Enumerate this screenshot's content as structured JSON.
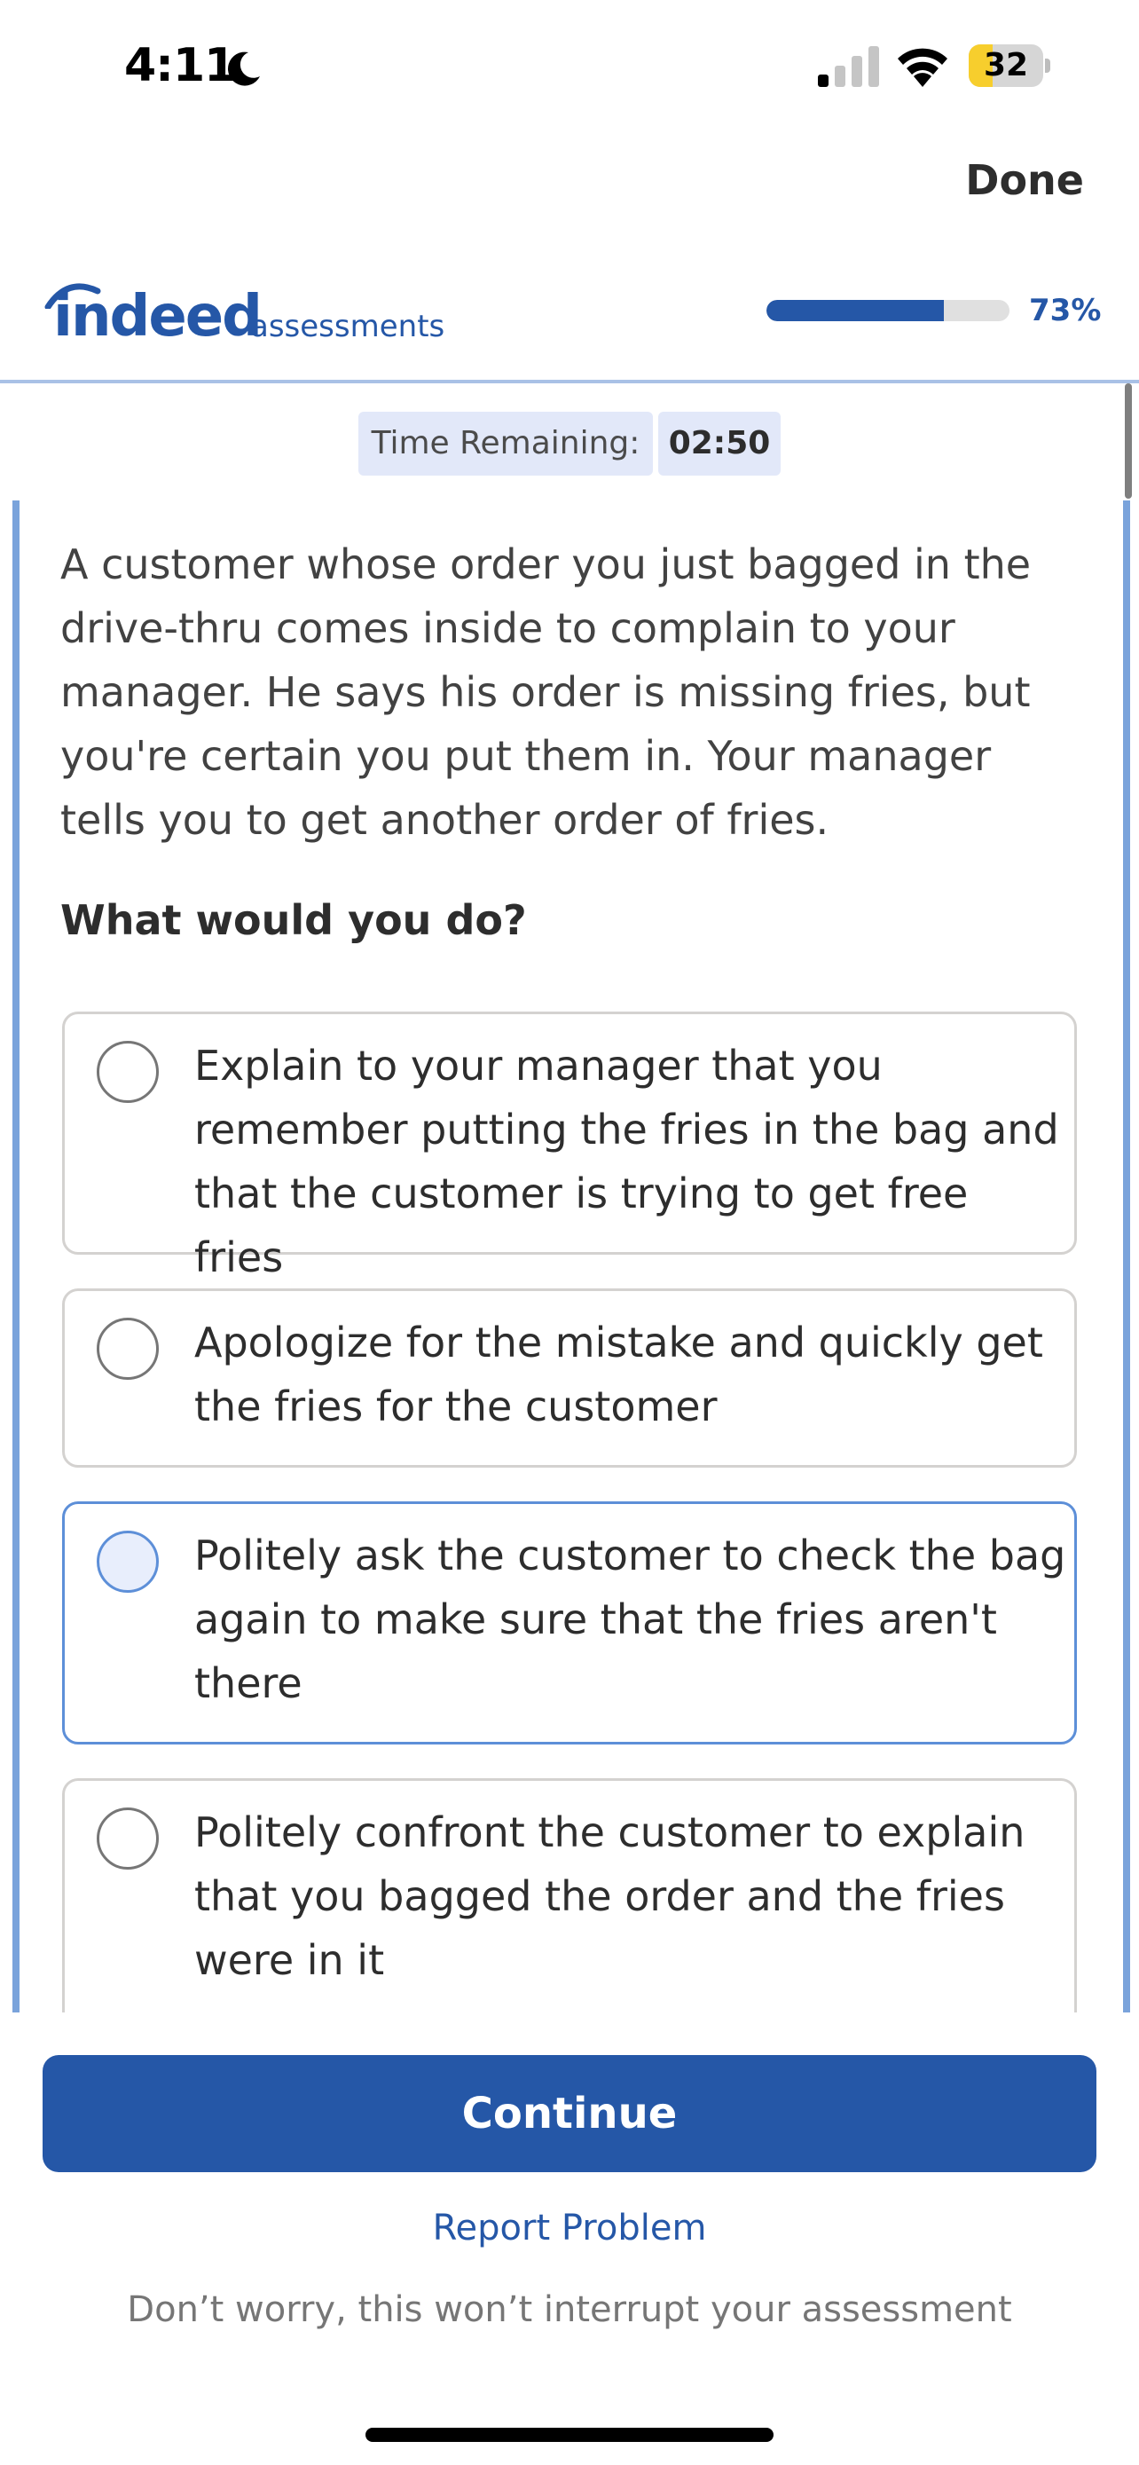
{
  "status_bar": {
    "time": "4:11",
    "battery_percent": "32",
    "battery_level": 0.32,
    "colors": {
      "battery": "#f7ce2d"
    }
  },
  "nav": {
    "done_label": "Done"
  },
  "header": {
    "logo_word": "indeed",
    "logo_sub": "assessments",
    "progress_label": "73%",
    "progress_value": 0.73,
    "colors": {
      "brand": "#2557a7"
    }
  },
  "timer": {
    "label": "Time Remaining:",
    "value": "02:50"
  },
  "question": {
    "text": "A customer whose order you just bagged in the drive-thru comes inside to complain to your manager. He says his order is missing fries, but you're certain you put them in. Your manager tells you to get another order of fries.",
    "prompt": "What would you do?"
  },
  "options": [
    {
      "text": "Explain to your manager that you remember putting the fries in the bag and that the customer is trying to get free fries"
    },
    {
      "text": "Apologize for the mistake and quickly get the fries for the customer"
    },
    {
      "text": "Politely ask the customer to check the bag again to make sure that the fries aren't there"
    },
    {
      "text": "Politely confront the customer to explain that you bagged the order and the fries were in it"
    }
  ],
  "footer": {
    "continue_label": "Continue",
    "report_label": "Report Problem",
    "reassure_text": "Don’t worry, this won’t interrupt your assessment"
  }
}
